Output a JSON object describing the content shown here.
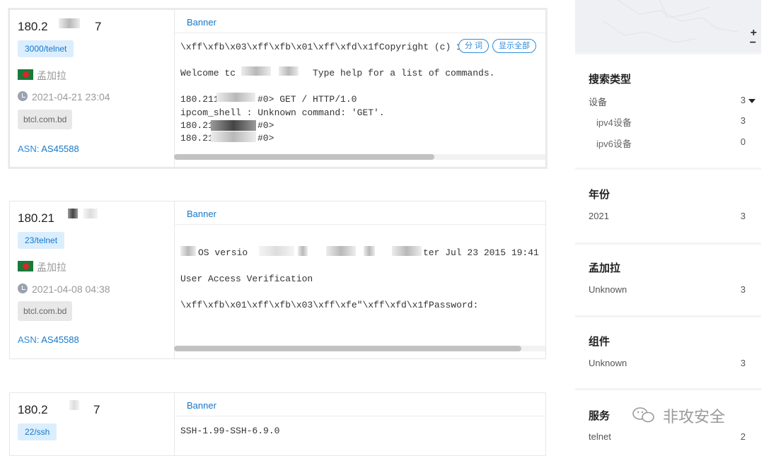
{
  "results": [
    {
      "ip_left": "180.2",
      "ip_right": "7",
      "port": "3000/telnet",
      "country": "孟加拉",
      "date": "2021-04-21 23:04",
      "domain": "btcl.com.bd",
      "asn_label": "ASN: ",
      "asn_value": "AS45588",
      "banner_title": "Banner",
      "pill_segment": "分 词",
      "pill_show_all": "显示全部",
      "banner_lines": [
        "\\xff\\xfb\\x03\\xff\\xfb\\x01\\xff\\xfd\\x1fCopyright (c) 1",
        "Welcome tc",
        "Type help for a list of commands.",
        "180.211",
        "#0> GET / HTTP/1.0",
        "ipcom_shell : Unknown command: 'GET'.",
        "180.21",
        "#0>",
        "180.21",
        "#0>"
      ]
    },
    {
      "ip_left": "180.21",
      "port": "23/telnet",
      "country": "孟加拉",
      "date": "2021-04-08 04:38",
      "domain": "btcl.com.bd",
      "asn_label": "ASN: ",
      "asn_value": "AS45588",
      "banner_title": "Banner",
      "banner_lines": [
        "OS versio",
        "ter Jul 23 2015 19:41",
        "User Access Verification",
        "\\xff\\xfb\\x01\\xff\\xfb\\x03\\xff\\xfe\"\\xff\\xfd\\x1fPassword:"
      ]
    },
    {
      "ip_left": "180.2",
      "ip_right": "7",
      "port": "22/ssh",
      "banner_title": "Banner",
      "banner_lines": [
        "SSH-1.99-SSH-6.9.0"
      ]
    }
  ],
  "sidebar": {
    "map": {
      "zoom_in": "+",
      "zoom_out": "−"
    },
    "search_type": {
      "title": "搜索类型",
      "rows": [
        {
          "label": "设备",
          "count": "3"
        },
        {
          "label": "ipv4设备",
          "count": "3"
        },
        {
          "label": "ipv6设备",
          "count": "0"
        }
      ]
    },
    "year": {
      "title": "年份",
      "rows": [
        {
          "label": "2021",
          "count": "3"
        }
      ]
    },
    "country": {
      "title": "孟加拉",
      "rows": [
        {
          "label": "Unknown",
          "count": "3"
        }
      ]
    },
    "component": {
      "title": "组件",
      "rows": [
        {
          "label": "Unknown",
          "count": "3"
        }
      ]
    },
    "service": {
      "title": "服务",
      "rows": [
        {
          "label": "telnet",
          "count": "2"
        }
      ]
    }
  },
  "watermark": "非攻安全"
}
